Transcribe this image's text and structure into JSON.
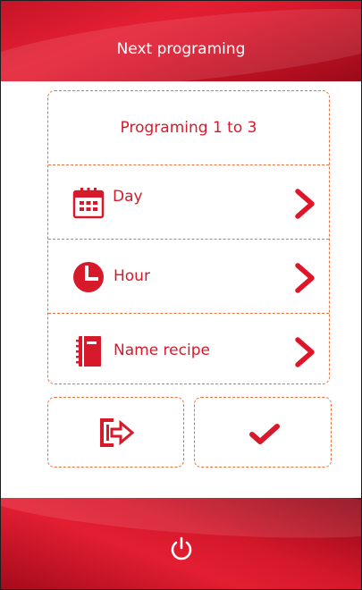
{
  "header": {
    "title": "Next programing"
  },
  "program": {
    "title": "Programing 1 to 3",
    "items": [
      {
        "label": "Day",
        "icon": "calendar-icon"
      },
      {
        "label": "Hour",
        "icon": "clock-icon"
      },
      {
        "label": "Name recipe",
        "icon": "recipe-book-icon"
      }
    ]
  },
  "actions": {
    "exit_icon": "exit-icon",
    "confirm_icon": "checkmark-icon"
  },
  "footer": {
    "power_icon": "power-icon"
  },
  "colors": {
    "accent": "#d71a2b",
    "border": "#e8713e",
    "header": "#d7172b"
  }
}
